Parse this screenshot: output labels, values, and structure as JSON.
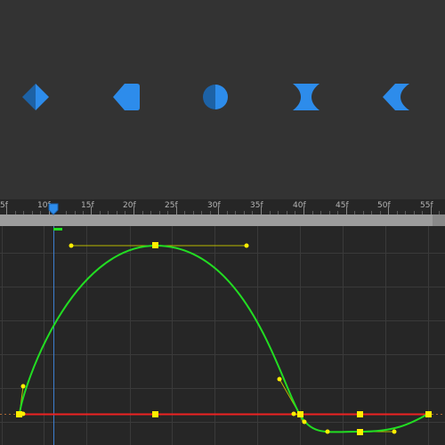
{
  "keyframe_icons": [
    {
      "name": "linear-keyframe-icon",
      "label": "Linear"
    },
    {
      "name": "ease-in-keyframe-icon",
      "label": "Ease in"
    },
    {
      "name": "bezier-keyframe-icon",
      "label": "Bezier"
    },
    {
      "name": "continuous-bezier-keyframe-icon",
      "label": "Continuous Bezier"
    },
    {
      "name": "ease-out-keyframe-icon",
      "label": "Ease out"
    }
  ],
  "ruler": {
    "labels": [
      "5f",
      "10f",
      "15f",
      "20f",
      "25f",
      "30f",
      "35f",
      "40f",
      "45f",
      "50f",
      "55f"
    ],
    "current_frame": 11
  },
  "colors": {
    "panel_bg": "#333333",
    "graph_bg": "#262626",
    "icon_blue": "#2d8ceb",
    "icon_blue_dark": "#1d62a6",
    "curve_green": "#22dd22",
    "curve_red": "#ee2222",
    "keyframe_yellow": "#ffee00",
    "handle_line": "#b8b800",
    "playhead_blue": "#3d7fd0"
  },
  "graph": {
    "green_curve_keyframes": [
      "9f",
      "23f",
      "40f",
      "47f",
      "55f"
    ],
    "red_curve_keyframes": [
      "9f",
      "23f",
      "40f",
      "47f",
      "55f"
    ]
  }
}
